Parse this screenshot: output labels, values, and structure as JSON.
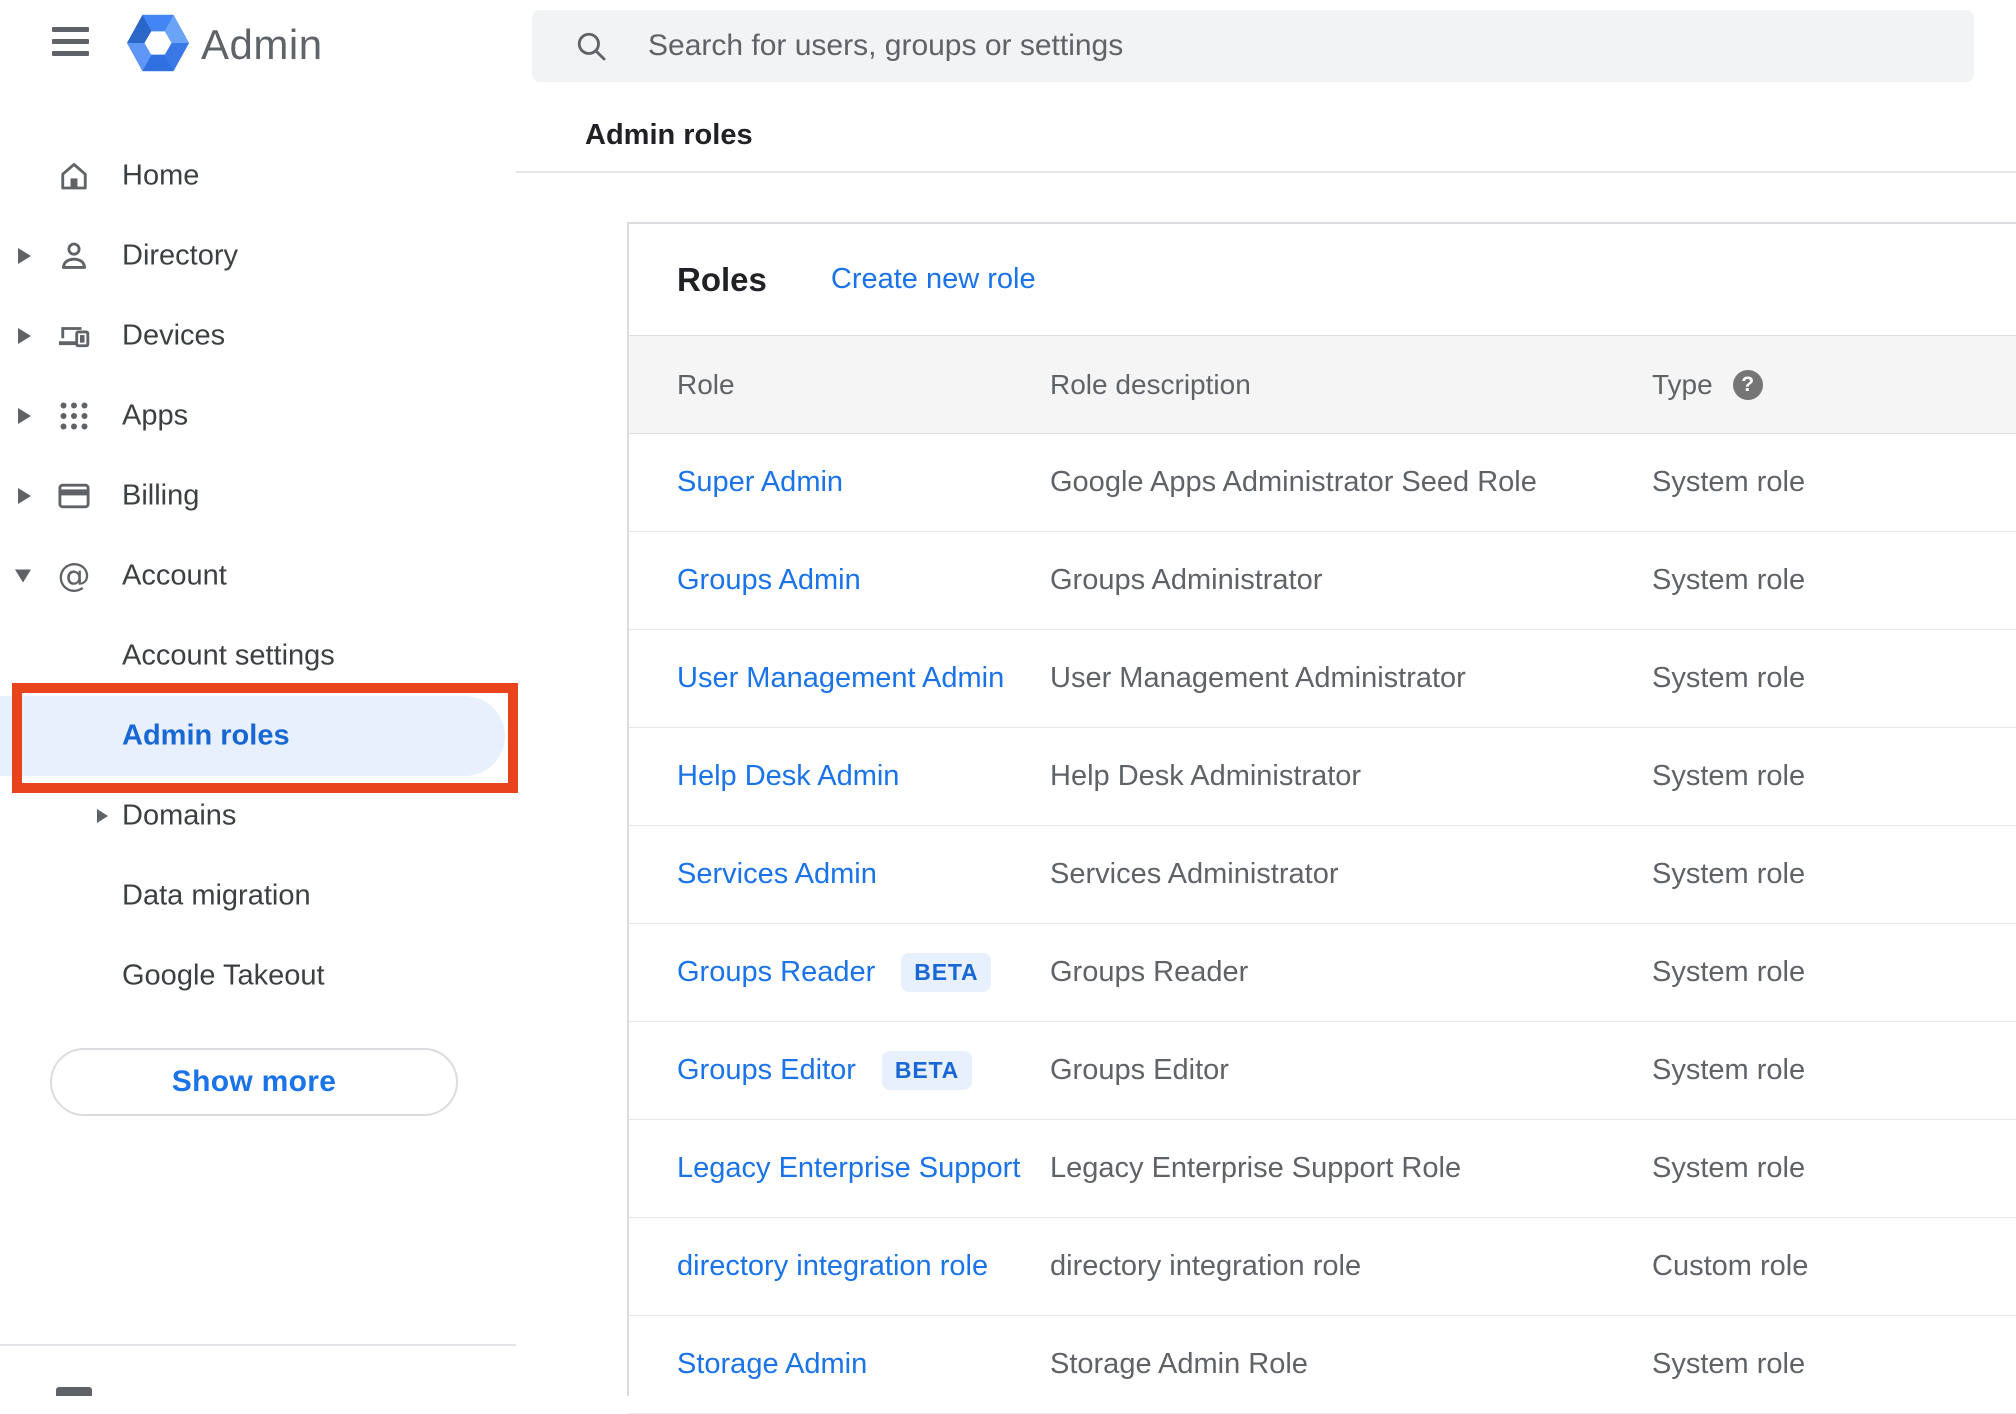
{
  "app": {
    "name": "Admin"
  },
  "topbar": {
    "search_placeholder": "Search for users, groups or settings"
  },
  "breadcrumb": "Admin roles",
  "icons": {
    "help_glyph": "?"
  },
  "sidebar": {
    "items": [
      {
        "label": "Home",
        "icon": "home",
        "arrow": "none",
        "child": false,
        "selected": false
      },
      {
        "label": "Directory",
        "icon": "person",
        "arrow": "right",
        "child": false,
        "selected": false
      },
      {
        "label": "Devices",
        "icon": "devices",
        "arrow": "right",
        "child": false,
        "selected": false
      },
      {
        "label": "Apps",
        "icon": "apps",
        "arrow": "right",
        "child": false,
        "selected": false
      },
      {
        "label": "Billing",
        "icon": "card",
        "arrow": "right",
        "child": false,
        "selected": false
      },
      {
        "label": "Account",
        "icon": "at",
        "arrow": "down",
        "child": false,
        "selected": false
      },
      {
        "label": "Account settings",
        "icon": "",
        "arrow": "none",
        "child": true,
        "selected": false
      },
      {
        "label": "Admin roles",
        "icon": "",
        "arrow": "none",
        "child": true,
        "selected": true
      },
      {
        "label": "Domains",
        "icon": "",
        "arrow": "right",
        "child": true,
        "selected": false
      },
      {
        "label": "Data migration",
        "icon": "",
        "arrow": "none",
        "child": true,
        "selected": false
      },
      {
        "label": "Google Takeout",
        "icon": "",
        "arrow": "none",
        "child": true,
        "selected": false
      }
    ],
    "show_more_label": "Show more"
  },
  "main": {
    "title": "Roles",
    "create_link": "Create new role",
    "table": {
      "columns": [
        "Role",
        "Role description",
        "Type"
      ],
      "beta_label": "BETA",
      "rows": [
        {
          "role": "Super Admin",
          "beta": false,
          "description": "Google Apps Administrator Seed Role",
          "type": "System role"
        },
        {
          "role": "Groups Admin",
          "beta": false,
          "description": "Groups Administrator",
          "type": "System role"
        },
        {
          "role": "User Management Admin",
          "beta": false,
          "description": "User Management Administrator",
          "type": "System role"
        },
        {
          "role": "Help Desk Admin",
          "beta": false,
          "description": "Help Desk Administrator",
          "type": "System role"
        },
        {
          "role": "Services Admin",
          "beta": false,
          "description": "Services Administrator",
          "type": "System role"
        },
        {
          "role": "Groups Reader",
          "beta": true,
          "description": "Groups Reader",
          "type": "System role"
        },
        {
          "role": "Groups Editor",
          "beta": true,
          "description": "Groups Editor",
          "type": "System role"
        },
        {
          "role": "Legacy Enterprise Support",
          "beta": false,
          "description": "Legacy Enterprise Support Role",
          "type": "System role"
        },
        {
          "role": "directory integration role",
          "beta": false,
          "description": "directory integration role",
          "type": "Custom role"
        },
        {
          "role": "Storage Admin",
          "beta": false,
          "description": "Storage Admin Role",
          "type": "System role"
        }
      ]
    }
  },
  "colors": {
    "accent_blue": "#1a73e8",
    "selected_blue": "#1967d2",
    "selected_bg": "#e8f0fe",
    "annotation_red": "#e8431c",
    "search_bg": "#f1f3f4",
    "table_header_bg": "#f5f5f5"
  }
}
